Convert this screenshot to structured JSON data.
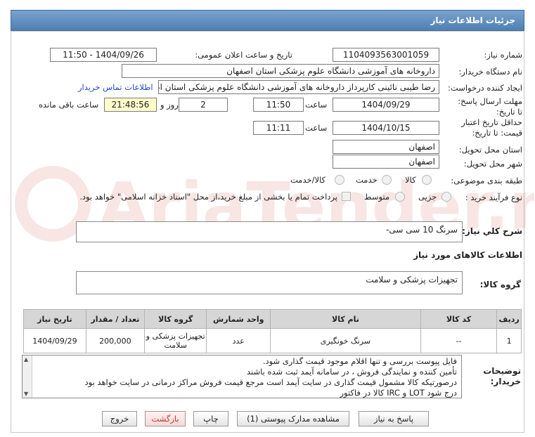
{
  "header": {
    "title": "جزئیات اطلاعات نیاز"
  },
  "fields": {
    "need_number_label": "شماره نیاز:",
    "need_number": "1104093563001059",
    "announce_label": "تاریخ و ساعت اعلان عمومی:",
    "announce_value": "1404/09/26 - 11:50",
    "buyer_org_label": "نام دستگاه خریدار:",
    "buyer_org": "داروخانه های آموزشی دانشگاه علوم پزشکی استان اصفهان",
    "creator_label": "ایجاد کننده درخواست:",
    "creator": "رضا طیبی نائینی کارپرداز داروخانه های آموزشی دانشگاه علوم پزشکی استان اص",
    "contact_link": "اطلاعات تماس خریدار",
    "deadline_label": "مهلت ارسال پاسخ: تا تاریخ:",
    "deadline_date": "1404/09/29",
    "time_word": "ساعت",
    "deadline_time": "11:50",
    "days_value": "2",
    "days_word": "روز و",
    "remaining_time": "21:48:56",
    "remaining_word": "ساعت باقی مانده",
    "validity_label": "حداقل تاریخ اعتبار قیمت: تا تاریخ:",
    "validity_date": "1404/10/15",
    "validity_time": "11:11",
    "province_label": "استان محل تحویل:",
    "province": "اصفهان",
    "city_label": "شهر محل تحویل:",
    "city": "اصفهان",
    "category_label": "طبقه بندی موضوعی:",
    "category_options": [
      "کالا",
      "خدمت",
      "کالا/خدمت"
    ],
    "process_label": "نوع فرآیند خرید :",
    "process_options": [
      "جزیی",
      "متوسط"
    ],
    "payment_note": "پرداخت تمام یا بخشی از مبلغ خرید،از محل \"اسناد خزانه اسلامی\" خواهد بود."
  },
  "need_desc": {
    "label": "شرح کلي نياز:",
    "value": "سرنگ 10 سی سی-"
  },
  "goods_info_title": "اطلاعات کالاهای مورد نیاز",
  "goods_group": {
    "label": "گروه کالا:",
    "value": "تجهیزات پزشکی و سلامت"
  },
  "table": {
    "headers": [
      "ردیف",
      "کد کالا",
      "نام کالا",
      "واحد شمارش",
      "گروه کالا",
      "تعداد / مقدار",
      "تاریخ نیاز"
    ],
    "rows": [
      [
        "1",
        "--",
        "سرنگ خونگیری",
        "عدد",
        "تجهیزات پزشکی و سلامت",
        "200,000",
        "1404/09/29"
      ]
    ]
  },
  "buyer_notes": {
    "label": "توضیحات خریدار:",
    "lines": [
      "فایل پیوست بررسی و تنها اقلام موجود قیمت گذاری شود.",
      "تأمین کننده و نمایندگی فروش ، در سامانه آیمد ثبت شده باشند",
      "درصورتیکه کالا مشمول قیمت گذاری در سایت آیمد است مرجع قیمت فروش مراکز درمانی در سایت خواهد بود",
      "درج شود LOT و IRC کالا در فاکتور"
    ]
  },
  "buttons": {
    "reply": "پاسخ به نیاز",
    "docs": "مشاهده مدارک پیوستی (1)",
    "print": "چاپ",
    "back": "بازگشت",
    "exit": "خروج"
  },
  "watermark": "AriaTender.neT"
}
